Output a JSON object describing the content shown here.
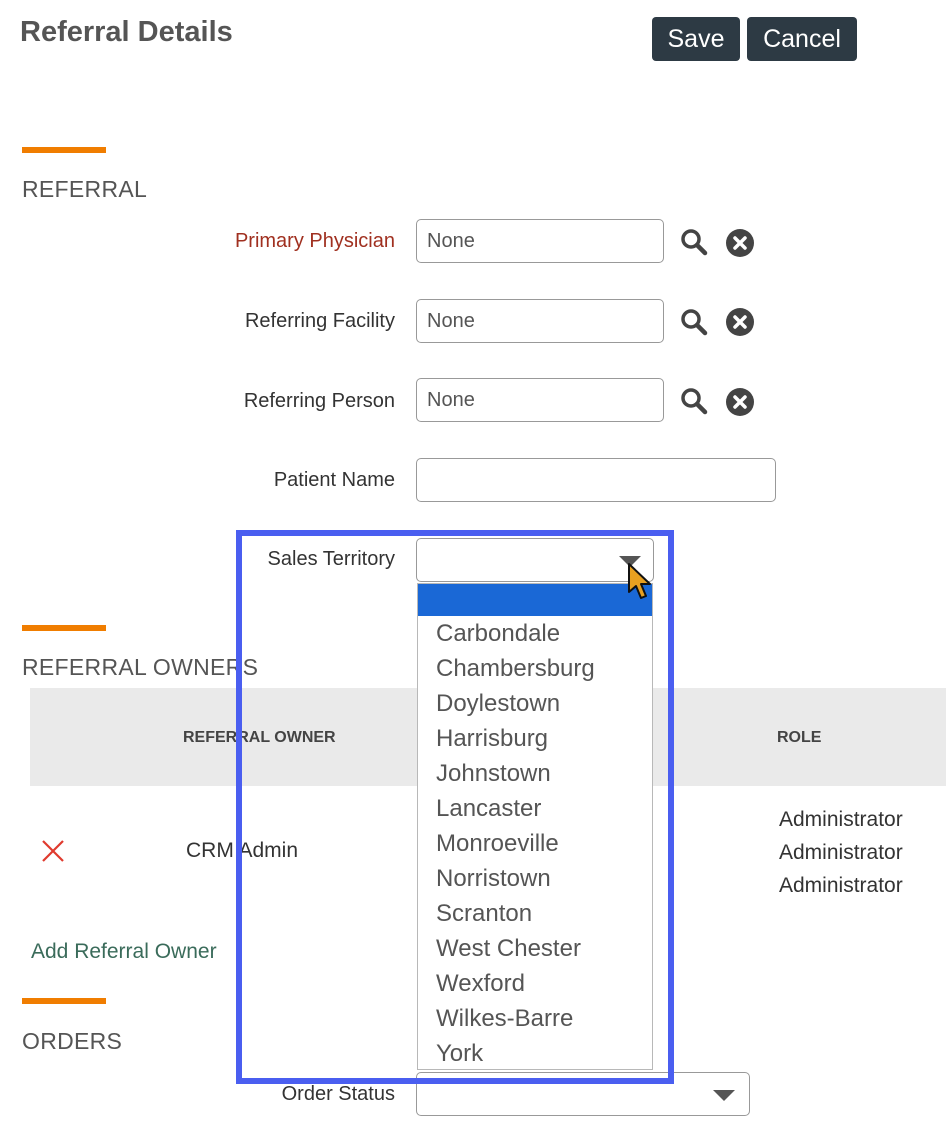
{
  "header": {
    "title": "Referral Details",
    "save_label": "Save",
    "cancel_label": "Cancel"
  },
  "sections": {
    "referral": "REFERRAL",
    "owners": "REFERRAL OWNERS",
    "orders": "ORDERS"
  },
  "fields": {
    "primary_physician": {
      "label": "Primary Physician",
      "value": "None"
    },
    "referring_facility": {
      "label": "Referring Facility",
      "value": "None"
    },
    "referring_person": {
      "label": "Referring Person",
      "value": "None"
    },
    "patient_name": {
      "label": "Patient Name",
      "value": ""
    },
    "sales_territory": {
      "label": "Sales Territory",
      "value": ""
    },
    "order_status": {
      "label": "Order Status",
      "value": ""
    }
  },
  "territory_options": [
    "",
    "Carbondale",
    "Chambersburg",
    "Doylestown",
    "Harrisburg",
    "Johnstown",
    "Lancaster",
    "Monroeville",
    "Norristown",
    "Scranton",
    "West Chester",
    "Wexford",
    "Wilkes-Barre",
    "York"
  ],
  "owners_table": {
    "columns": [
      "REFERRAL OWNER",
      "ROLE"
    ],
    "rows": [
      {
        "owner": "CRM Admin",
        "roles": [
          "Administrator",
          "Administrator",
          "Administrator"
        ]
      }
    ],
    "add_label": "Add Referral Owner"
  },
  "colors": {
    "accent": "#f07d00",
    "highlight_border": "#4a5ef0",
    "selected_option": "#1a68d6",
    "button_bg": "#2d3a44"
  },
  "icons": {
    "lookup": "search-icon",
    "clear": "clear-circle-icon",
    "remove": "close-icon",
    "cursor": "mouse-pointer-icon"
  }
}
